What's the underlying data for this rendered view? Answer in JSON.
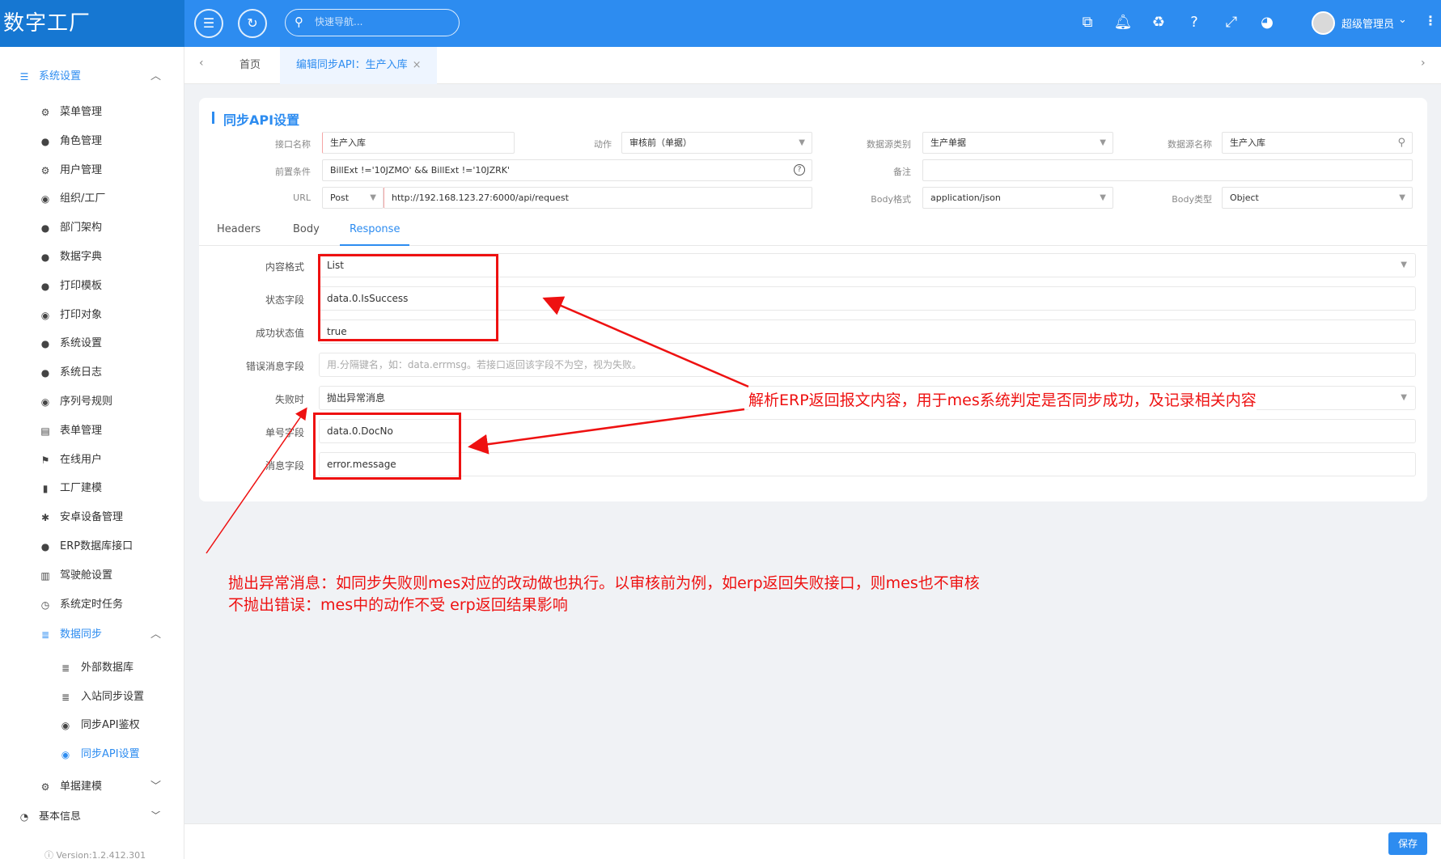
{
  "app": {
    "brand": "数字工厂"
  },
  "header": {
    "search_placeholder": "快速导航...",
    "user_name": "超级管理员"
  },
  "sidebar": {
    "group_system": "系统设置",
    "items": [
      "菜单管理",
      "角色管理",
      "用户管理",
      "组织/工厂",
      "部门架构",
      "数据字典",
      "打印模板",
      "打印对象",
      "系统设置",
      "系统日志",
      "序列号规则",
      "表单管理",
      "在线用户",
      "工厂建模",
      "安卓设备管理",
      "ERP数据库接口",
      "驾驶舱设置",
      "系统定时任务"
    ],
    "group_sync": "数据同步",
    "sync_items": [
      "外部数据库",
      "入站同步设置",
      "同步API鉴权",
      "同步API设置"
    ],
    "group_doc": "单据建模",
    "group_basic": "基本信息",
    "version": "Version:1.2.412.301"
  },
  "tabs": {
    "home": "首页",
    "active": "编辑同步API：生产入库"
  },
  "card": {
    "title": "同步API设置",
    "fields": {
      "api_name_label": "接口名称",
      "api_name_value": "生产入库",
      "action_label": "动作",
      "action_value": "审核前（单据）",
      "ds_type_label": "数据源类别",
      "ds_type_value": "生产单据",
      "ds_name_label": "数据源名称",
      "ds_name_value": "生产入库",
      "precond_label": "前置条件",
      "precond_value": "BillExt !='10JZMO'  &&  BillExt !='10JZRK'",
      "remark_label": "备注",
      "remark_value": "",
      "url_label": "URL",
      "method_value": "Post",
      "url_value": "http://192.168.123.27:6000/api/request",
      "body_format_label": "Body格式",
      "body_format_value": "application/json",
      "body_type_label": "Body类型",
      "body_type_value": "Object"
    },
    "subtabs": [
      "Headers",
      "Body",
      "Response"
    ],
    "response": {
      "content_format_label": "内容格式",
      "content_format_value": "List",
      "status_field_label": "状态字段",
      "status_field_value": "data.0.IsSuccess",
      "success_value_label": "成功状态值",
      "success_value_value": "true",
      "error_field_label": "错误消息字段",
      "error_field_placeholder": "用.分隔键名，如：data.errmsg。若接口返回该字段不为空，视为失败。",
      "on_fail_label": "失败时",
      "on_fail_value": "抛出异常消息",
      "doc_no_field_label": "单号字段",
      "doc_no_field_value": "data.0.DocNo",
      "message_field_label": "消息字段",
      "message_field_value": "error.message"
    }
  },
  "annotations": {
    "parse_note": "解析ERP返回报文内容，用于mes系统判定是否同步成功，及记录相关内容",
    "throw_note_1": "抛出异常消息：如同步失败则mes对应的改动做也执行。以审核前为例，如erp返回失败接口，则mes也不审核",
    "throw_note_2": "不抛出错误：mes中的动作不受 erp返回结果影响",
    "color": "#ee1111"
  },
  "footer": {
    "save_label": "保存"
  },
  "colors": {
    "primary": "#2d8cf0",
    "brand_bg": "#1677d2"
  }
}
